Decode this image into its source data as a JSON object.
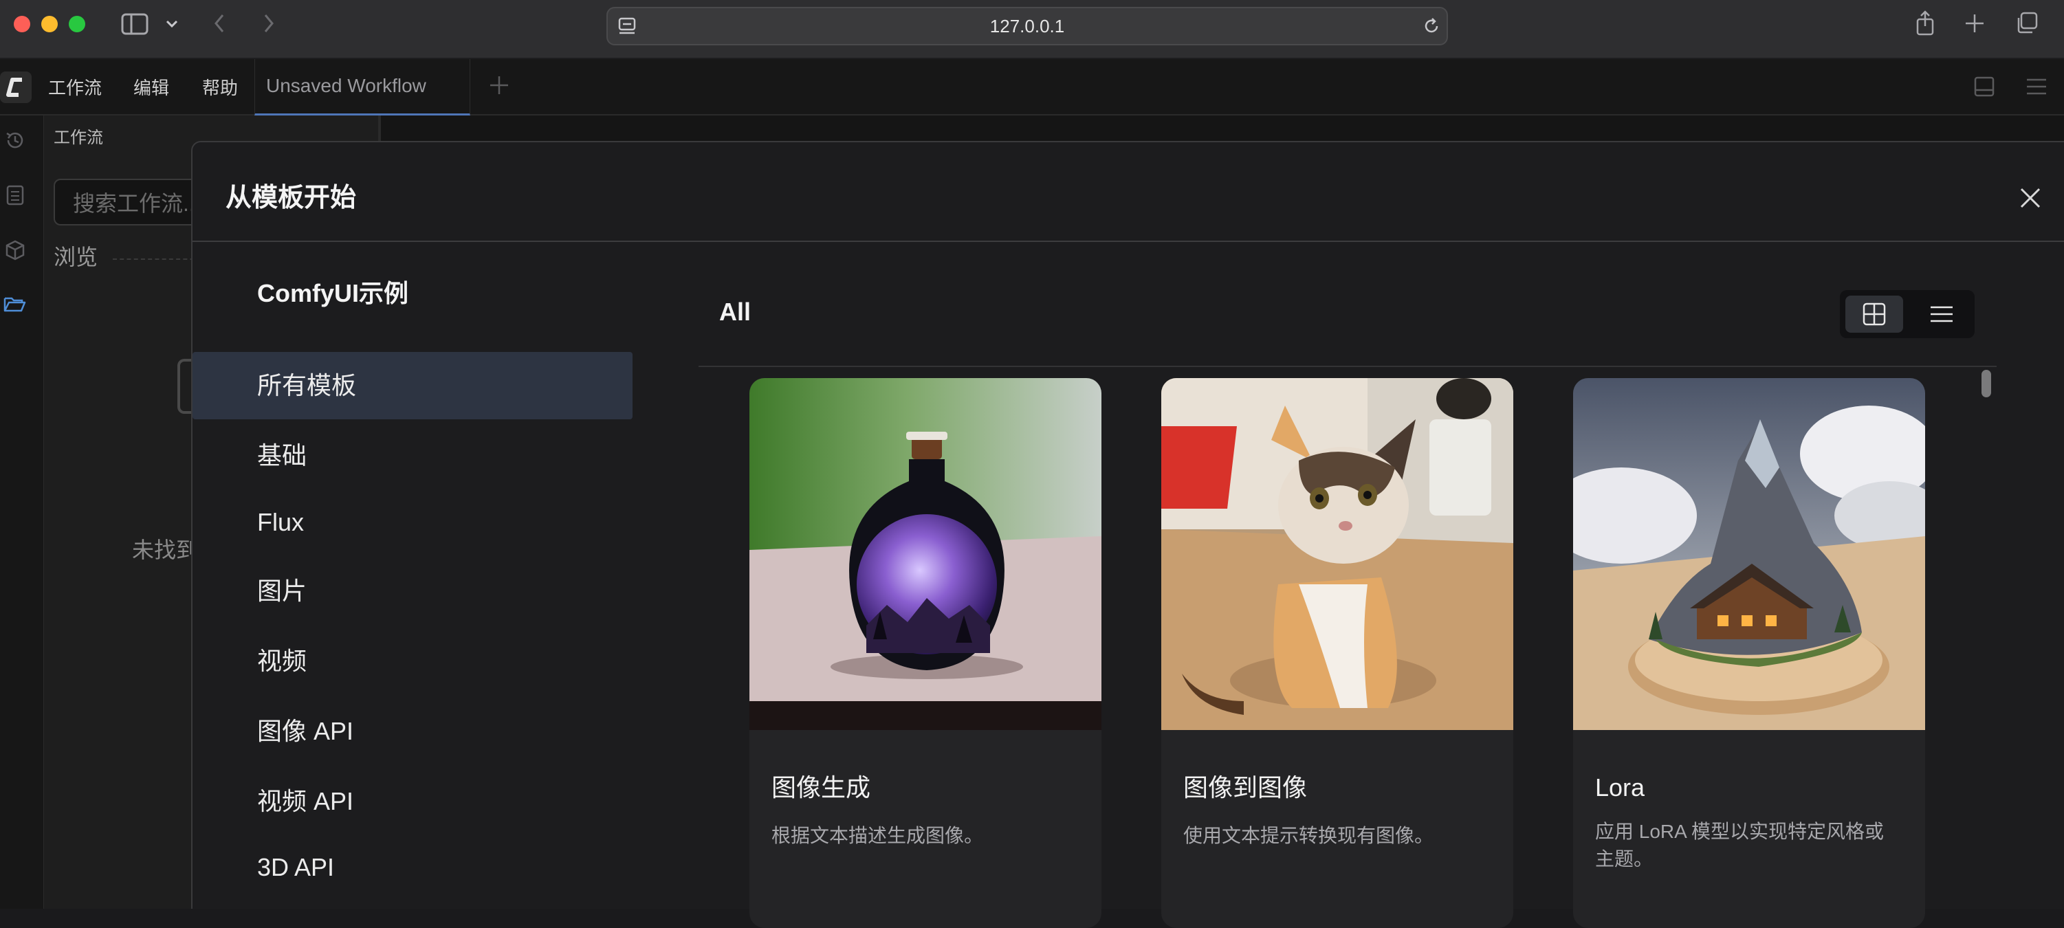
{
  "browser": {
    "url": "127.0.0.1"
  },
  "menu": {
    "workflow": "工作流",
    "edit": "编辑",
    "help": "帮助"
  },
  "tab": {
    "title": "Unsaved Workflow"
  },
  "sidebar": {
    "title": "工作流",
    "search_placeholder": "搜索工作流...",
    "browse": "浏览",
    "empty_text": "未找到"
  },
  "modal": {
    "title": "从模板开始",
    "nav_title": "ComfyUI示例",
    "nav_items": [
      "所有模板",
      "基础",
      "Flux",
      "图片",
      "视频",
      "图像 API",
      "视频 API",
      "3D API"
    ],
    "selected_nav": "所有模板",
    "section_title": "All",
    "view_mode": "grid",
    "cards": [
      {
        "title": "图像生成",
        "desc": "根据文本描述生成图像。"
      },
      {
        "title": "图像到图像",
        "desc": "使用文本提示转换现有图像。"
      },
      {
        "title": "Lora",
        "desc_line1": "应用 LoRA 模型以实现特定风格或",
        "desc_line2": "主题。"
      }
    ]
  },
  "colors": {
    "accent": "#4f76b8",
    "selected_bg": "#2d3442",
    "modal_bg": "#1c1c1e"
  }
}
